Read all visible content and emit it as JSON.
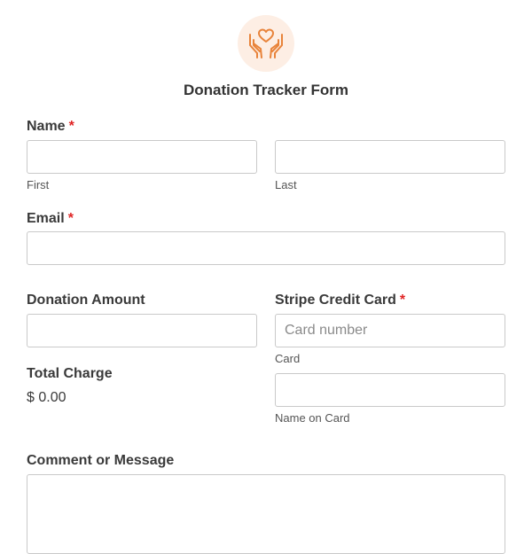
{
  "form": {
    "title": "Donation Tracker Form",
    "logo_icon": "heart-in-hands-icon",
    "accent_color": "#e8833a",
    "required_marker": "*"
  },
  "name": {
    "label": "Name",
    "required": true,
    "first": {
      "value": "",
      "sublabel": "First"
    },
    "last": {
      "value": "",
      "sublabel": "Last"
    }
  },
  "email": {
    "label": "Email",
    "required": true,
    "value": ""
  },
  "donation_amount": {
    "label": "Donation Amount",
    "value": ""
  },
  "total_charge": {
    "label": "Total Charge",
    "value": "$ 0.00"
  },
  "stripe": {
    "label": "Stripe Credit Card",
    "required": true,
    "card": {
      "value": "",
      "placeholder": "Card number",
      "sublabel": "Card"
    },
    "name_on_card": {
      "value": "",
      "sublabel": "Name on Card"
    }
  },
  "comment": {
    "label": "Comment or Message",
    "value": ""
  }
}
